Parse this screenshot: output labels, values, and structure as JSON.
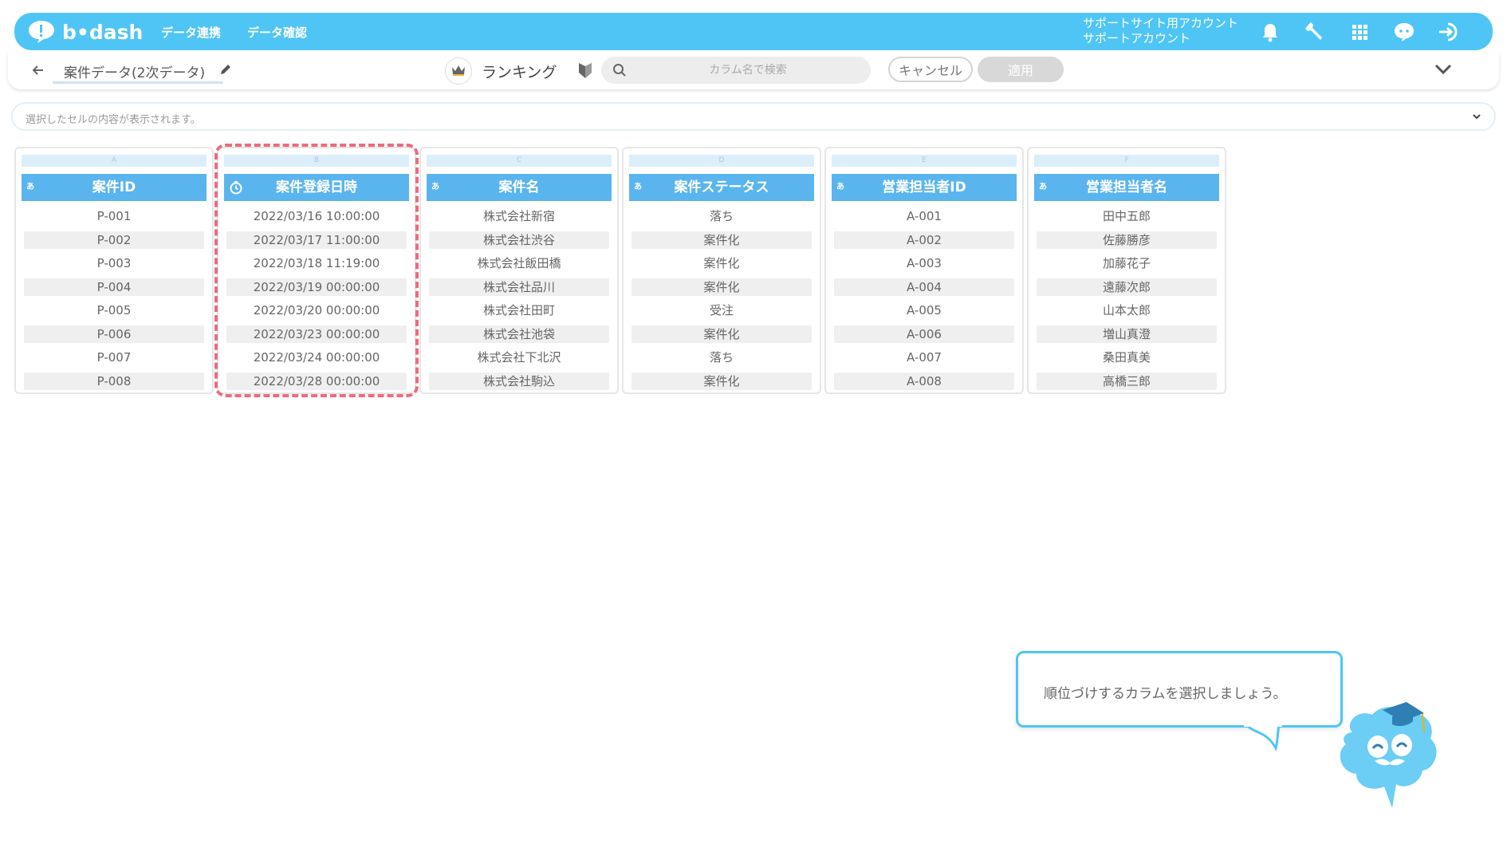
{
  "header": {
    "logo_text": "b•dash",
    "nav": [
      "データ連携",
      "データ確認"
    ],
    "account_line1": "サポートサイト用アカウント",
    "account_line2": "サポートアカウント",
    "icons": [
      "bell-icon",
      "wrench-icon",
      "grid-icon",
      "chat-icon",
      "logout-icon"
    ],
    "color": "#4fc5f5"
  },
  "subbar": {
    "dataset_name": "案件データ(2次データ)",
    "mode_label": "ランキング",
    "search_placeholder": "カラム名で検索",
    "cancel_label": "キャンセル",
    "apply_label": "適用"
  },
  "cell_bar": {
    "placeholder": "選択したセルの内容が表示されます。"
  },
  "columns": [
    {
      "letter": "A",
      "type": "あ",
      "name": "案件ID",
      "values": [
        "P-001",
        "P-002",
        "P-003",
        "P-004",
        "P-005",
        "P-006",
        "P-007",
        "P-008"
      ]
    },
    {
      "letter": "B",
      "type": "clock",
      "name": "案件登録日時",
      "values": [
        "2022/03/16 10:00:00",
        "2022/03/17 11:00:00",
        "2022/03/18 11:19:00",
        "2022/03/19 00:00:00",
        "2022/03/20 00:00:00",
        "2022/03/23 00:00:00",
        "2022/03/24 00:00:00",
        "2022/03/28 00:00:00"
      ]
    },
    {
      "letter": "C",
      "type": "あ",
      "name": "案件名",
      "values": [
        "株式会社新宿",
        "株式会社渋谷",
        "株式会社飯田橋",
        "株式会社品川",
        "株式会社田町",
        "株式会社池袋",
        "株式会社下北沢",
        "株式会社駒込"
      ]
    },
    {
      "letter": "D",
      "type": "あ",
      "name": "案件ステータス",
      "values": [
        "落ち",
        "案件化",
        "案件化",
        "案件化",
        "受注",
        "案件化",
        "落ち",
        "案件化"
      ]
    },
    {
      "letter": "E",
      "type": "あ",
      "name": "営業担当者ID",
      "values": [
        "A-001",
        "A-002",
        "A-003",
        "A-004",
        "A-005",
        "A-006",
        "A-007",
        "A-008"
      ]
    },
    {
      "letter": "F",
      "type": "あ",
      "name": "営業担当者名",
      "values": [
        "田中五郎",
        "佐藤勝彦",
        "加藤花子",
        "遠藤次郎",
        "山本太郎",
        "増山真澄",
        "桑田真美",
        "高橋三郎"
      ]
    }
  ],
  "highlighted_column": "B",
  "tooltip": {
    "text": "順位づけするカラムを選択しましょう。"
  },
  "colors": {
    "accent": "#4fc5f5",
    "column_header": "#5ab5ee",
    "highlight_dash": "#ef6a7d"
  }
}
